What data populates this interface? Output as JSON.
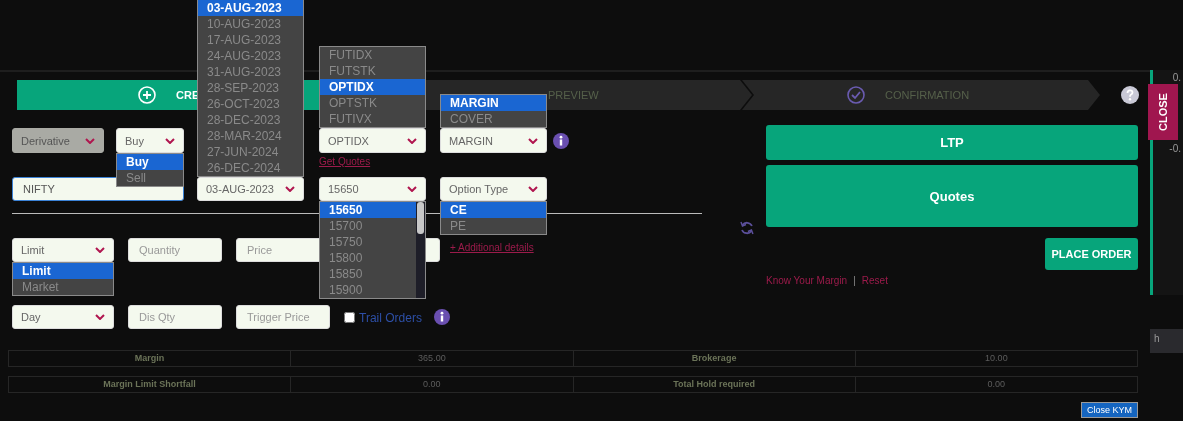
{
  "steps": [
    {
      "label": "CRE",
      "selected": true
    },
    {
      "label": "PREVIEW",
      "selected": false
    },
    {
      "label": "CONFIRMATION",
      "selected": false
    }
  ],
  "form": {
    "rows": [
      [
        {
          "kind": "select",
          "value": "Derivative",
          "disabled": true
        },
        {
          "kind": "select",
          "value": "Buy",
          "disabled": false,
          "list": {
            "kind": "dropdown",
            "options": [
              {
                "label": "Buy",
                "selected": true
              },
              {
                "label": "Sell",
                "selected": false
              }
            ]
          }
        },
        {
          "kind": "select",
          "value": "OPTIDX",
          "disabled": false,
          "link": "Get Quotes",
          "list": {
            "kind": "dropup",
            "options": [
              {
                "label": "FUTIDX",
                "selected": false
              },
              {
                "label": "FUTSTK",
                "selected": false
              },
              {
                "label": "OPTIDX",
                "selected": true
              },
              {
                "label": "OPTSTK",
                "selected": false
              },
              {
                "label": "FUTIVX",
                "selected": false
              }
            ]
          }
        },
        {
          "kind": "select",
          "value": "MARGIN",
          "disabled": false,
          "list": {
            "kind": "dropup",
            "options": [
              {
                "label": "MARGIN",
                "selected": true
              },
              {
                "label": "COVER",
                "selected": false
              }
            ]
          }
        },
        {
          "kind": "info"
        }
      ],
      [
        {
          "kind": "input",
          "value": "NIFTY",
          "focused": true
        },
        {
          "kind": "select",
          "value": "03-AUG-2023",
          "disabled": false,
          "list": {
            "kind": "dropup",
            "options": [
              {
                "label": "03-AUG-2023",
                "selected": true
              },
              {
                "label": "10-AUG-2023",
                "selected": false
              },
              {
                "label": "17-AUG-2023",
                "selected": false
              },
              {
                "label": "24-AUG-2023",
                "selected": false
              },
              {
                "label": "31-AUG-2023",
                "selected": false
              },
              {
                "label": "28-SEP-2023",
                "selected": false
              },
              {
                "label": "26-OCT-2023",
                "selected": false
              },
              {
                "label": "28-DEC-2023",
                "selected": false
              },
              {
                "label": "28-MAR-2024",
                "selected": false
              },
              {
                "label": "27-JUN-2024",
                "selected": false
              },
              {
                "label": "26-DEC-2024",
                "selected": false
              }
            ]
          }
        },
        {
          "kind": "select",
          "value": "15650",
          "disabled": false,
          "list": {
            "kind": "dropdown",
            "scrollable": true,
            "options": [
              {
                "label": "15650",
                "selected": true
              },
              {
                "label": "15700",
                "selected": false
              },
              {
                "label": "15750",
                "selected": false
              },
              {
                "label": "15800",
                "selected": false
              },
              {
                "label": "15850",
                "selected": false
              },
              {
                "label": "15900",
                "selected": false
              }
            ]
          }
        },
        {
          "kind": "select",
          "value": "Option Type",
          "disabled": false,
          "list": {
            "kind": "dropdown",
            "options": [
              {
                "label": "CE",
                "selected": true
              },
              {
                "label": "PE",
                "selected": false
              }
            ]
          }
        }
      ],
      [
        {
          "kind": "select",
          "value": "Limit",
          "disabled": false,
          "list": {
            "kind": "dropdown",
            "options": [
              {
                "label": "Limit",
                "selected": true
              },
              {
                "label": "Market",
                "selected": false
              }
            ]
          }
        },
        {
          "kind": "input",
          "placeholder": "Quantity",
          "focused": false
        },
        {
          "kind": "input",
          "placeholder": "Price",
          "focused": false
        },
        {
          "kind": "link",
          "label": "+ Additional details"
        }
      ],
      [
        {
          "kind": "select",
          "value": "Day",
          "disabled": false
        },
        {
          "kind": "input",
          "placeholder": "Dis Qty",
          "focused": false
        },
        {
          "kind": "input",
          "placeholder": "Trigger Price",
          "focused": false
        },
        {
          "kind": "checkbox",
          "label": "Trail Orders",
          "checked": false
        },
        {
          "kind": "info"
        }
      ]
    ]
  },
  "side": {
    "buttons": [
      "LTP",
      "Quotes"
    ],
    "place_order": "PLACE ORDER",
    "links": [
      "Know Your Margin",
      "Reset"
    ],
    "separator": "|"
  },
  "summary": [
    [
      {
        "label": "Margin",
        "value": "365.00"
      },
      {
        "label": "Brokerage",
        "value": "10.00"
      }
    ],
    [
      {
        "label": "Margin Limit Shortfall",
        "value": "0.00"
      },
      {
        "label": "Total Hold required",
        "value": "0.00"
      }
    ]
  ],
  "close_kym": "Close KYM",
  "close_tab": "CLOSE",
  "right_strip": [
    "0.",
    "-0.",
    "h"
  ]
}
